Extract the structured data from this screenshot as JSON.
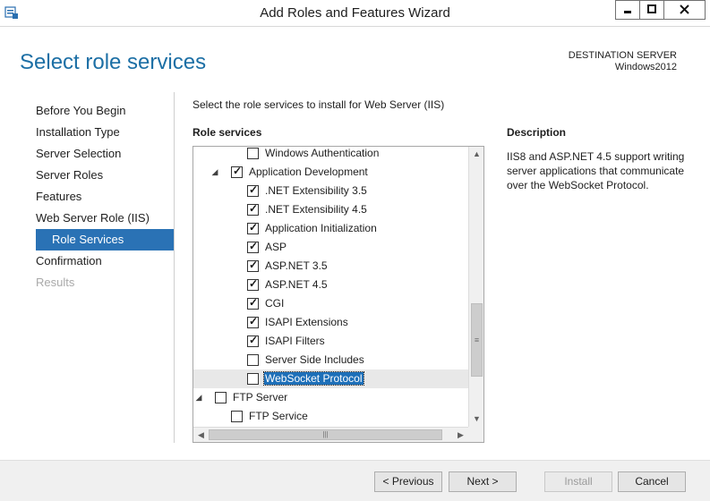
{
  "window": {
    "title": "Add Roles and Features Wizard",
    "controls": {
      "minimize": "▬",
      "maximize": "□",
      "close": "✕"
    }
  },
  "page_title": "Select role services",
  "destination": {
    "label": "DESTINATION SERVER",
    "server": "Windows2012"
  },
  "nav": {
    "items": [
      {
        "label": "Before You Begin"
      },
      {
        "label": "Installation Type"
      },
      {
        "label": "Server Selection"
      },
      {
        "label": "Server Roles"
      },
      {
        "label": "Features"
      },
      {
        "label": "Web Server Role (IIS)"
      },
      {
        "label": "Role Services"
      },
      {
        "label": "Confirmation"
      },
      {
        "label": "Results"
      }
    ]
  },
  "instruction": "Select the role services to install for Web Server (IIS)",
  "role_services": {
    "header": "Role services",
    "rows": [
      {
        "label": "Windows Authentication",
        "checked": false,
        "level": 2
      },
      {
        "label": "Application Development",
        "checked": true,
        "level": 1,
        "expanded": true
      },
      {
        "label": ".NET Extensibility 3.5",
        "checked": true,
        "level": 2
      },
      {
        "label": ".NET Extensibility 4.5",
        "checked": true,
        "level": 2
      },
      {
        "label": "Application Initialization",
        "checked": true,
        "level": 2
      },
      {
        "label": "ASP",
        "checked": true,
        "level": 2
      },
      {
        "label": "ASP.NET 3.5",
        "checked": true,
        "level": 2
      },
      {
        "label": "ASP.NET 4.5",
        "checked": true,
        "level": 2
      },
      {
        "label": "CGI",
        "checked": true,
        "level": 2
      },
      {
        "label": "ISAPI Extensions",
        "checked": true,
        "level": 2
      },
      {
        "label": "ISAPI Filters",
        "checked": true,
        "level": 2
      },
      {
        "label": "Server Side Includes",
        "checked": false,
        "level": 2
      },
      {
        "label": "WebSocket Protocol",
        "checked": false,
        "level": 2,
        "selected": true
      },
      {
        "label": "FTP Server",
        "checked": false,
        "level": 0,
        "expanded": true
      },
      {
        "label": "FTP Service",
        "checked": false,
        "level": 1
      }
    ]
  },
  "description": {
    "header": "Description",
    "text": "IIS8 and ASP.NET 4.5 support writing server applications that communicate over the WebSocket Protocol."
  },
  "buttons": {
    "previous": "< Previous",
    "next": "Next >",
    "install": "Install",
    "cancel": "Cancel"
  }
}
